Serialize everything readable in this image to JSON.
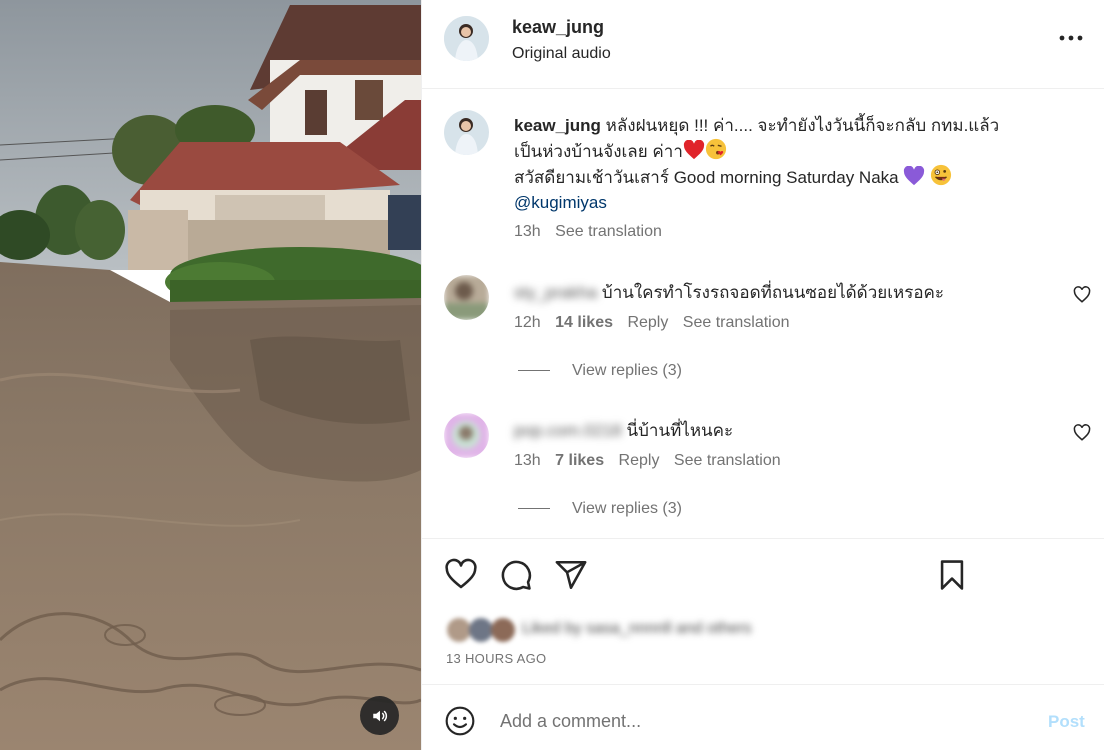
{
  "post": {
    "username": "keaw_jung",
    "audio": "Original audio",
    "caption": {
      "username": "keaw_jung",
      "line1": "หลังฝนหยุด !!! ค่า.... จะทำยังไงวันนี้ก็จะกลับ กทม.แล้ว",
      "line2": "เป็นห่วงบ้านจังเลย ค่าา",
      "line3": "สวัสดียามเช้าวันเสาร์ Good morning Saturday Naka",
      "mention": "@kugimiyas"
    },
    "caption_time": "13h",
    "see_translation": "See translation",
    "timestamp": "13 HOURS AGO",
    "liked_by": "Liked by sasa_nnnnll and others"
  },
  "comments": [
    {
      "username": "sty_prakha",
      "text": "บ้านใครทำโรงรถจอดที่ถนนซอยได้ด้วยเหรอคะ",
      "time": "12h",
      "likes": "14 likes",
      "reply": "Reply",
      "see_translation": "See translation",
      "view_replies": "View replies (3)"
    },
    {
      "username": "pop.com.0218",
      "text": "นี่บ้านที่ไหนคะ",
      "time": "13h",
      "likes": "7 likes",
      "reply": "Reply",
      "see_translation": "See translation",
      "view_replies": "View replies (3)"
    }
  ],
  "comment_box": {
    "placeholder": "Add a comment...",
    "post_label": "Post"
  },
  "icons": {
    "more": "more-horizontal-icon",
    "like": "heart-icon",
    "comment": "comment-icon",
    "share": "paper-plane-icon",
    "save": "bookmark-icon",
    "emoji": "smiley-icon",
    "sound": "speaker-icon"
  },
  "colors": {
    "text": "#262626",
    "secondary": "#737373",
    "link": "#00376b",
    "post_disabled": "#b2dffc",
    "divider": "#efefef"
  }
}
